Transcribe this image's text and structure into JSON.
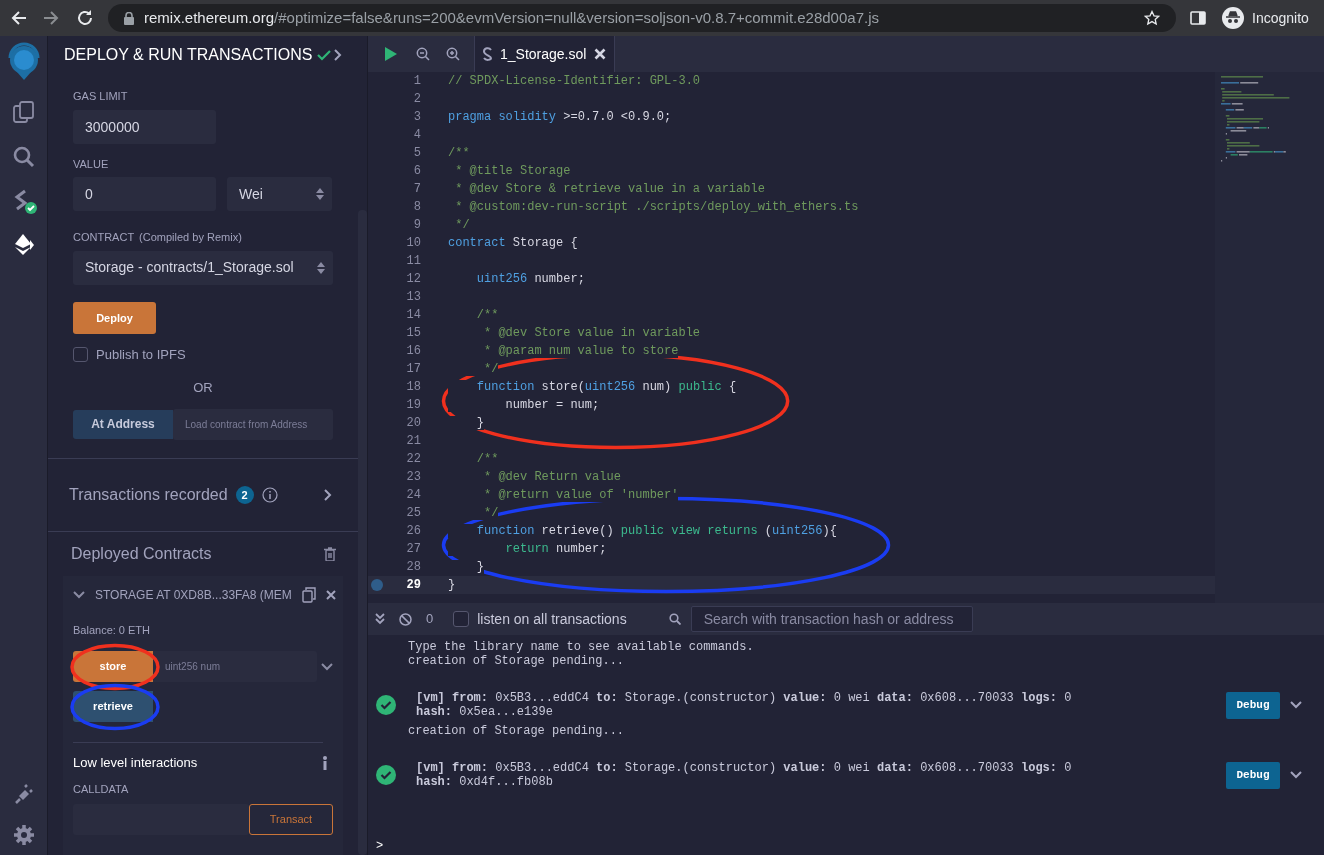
{
  "browser": {
    "url_host": "remix.ethereum.org",
    "url_path": "/#optimize=false&runs=200&evmVersion=null&version=soljson-v0.8.7+commit.e28d00a7.js",
    "profile": "Incognito"
  },
  "icon_rail": {
    "top": [
      {
        "kind": "files",
        "selected": false,
        "verified": false
      },
      {
        "kind": "search",
        "selected": false,
        "verified": false
      },
      {
        "kind": "compiler",
        "selected": false,
        "verified": true
      },
      {
        "kind": "deploy",
        "selected": true,
        "verified": false
      }
    ],
    "bottom": [
      {
        "kind": "plugins"
      },
      {
        "kind": "settings"
      }
    ]
  },
  "panel": {
    "title": "DEPLOY & RUN TRANSACTIONS",
    "verified": true,
    "gas_limit": {
      "label": "GAS LIMIT",
      "value": "3000000"
    },
    "value": {
      "label": "VALUE",
      "value": "0",
      "unit": "Wei"
    },
    "contract": {
      "label": "CONTRACT",
      "note": "(Compiled by Remix)",
      "value": "Storage - contracts/1_Storage.sol"
    },
    "deploy_button": "Deploy",
    "publish": {
      "label": "Publish to IPFS",
      "checked": false
    },
    "or_label": "OR",
    "at_address": {
      "button": "At Address",
      "placeholder": "Load contract from Address"
    },
    "transactions_recorded": {
      "label": "Transactions recorded",
      "count": "2"
    },
    "deployed": {
      "title": "Deployed Contracts",
      "instances": [
        {
          "title": "STORAGE AT 0XD8B...33FA8 (MEM",
          "expanded": true,
          "balance": "Balance: 0 ETH",
          "functions": [
            {
              "label": "store",
              "kind": "transact",
              "placeholder": "uint256 num",
              "color": "#f0301e"
            },
            {
              "label": "retrieve",
              "kind": "call",
              "color": "#1a3cf2"
            }
          ],
          "low_level": {
            "title": "Low level interactions",
            "calldata_label": "CALLDATA",
            "button": "Transact"
          }
        }
      ]
    }
  },
  "editor": {
    "tabs": [
      {
        "label": "1_Storage.sol",
        "selected": true
      }
    ],
    "lines": [
      {
        "number": "1",
        "current": false,
        "tokens": [
          {
            "kind": "comment",
            "text": "// SPDX-License-Identifier: GPL-3.0"
          }
        ]
      },
      {
        "number": "2",
        "current": false
      },
      {
        "number": "3",
        "current": false,
        "tokens": [
          {
            "kind": "keyword",
            "text": "pragma solidity"
          },
          {
            "kind": "plain",
            "text": " >=0.7.0 <0.9.0;"
          }
        ]
      },
      {
        "number": "4",
        "current": false
      },
      {
        "number": "5",
        "current": false,
        "tokens": [
          {
            "kind": "comment",
            "text": "/**"
          }
        ]
      },
      {
        "number": "6",
        "current": false,
        "tokens": [
          {
            "kind": "comment",
            "text": " * @title Storage"
          }
        ]
      },
      {
        "number": "7",
        "current": false,
        "tokens": [
          {
            "kind": "comment",
            "text": " * @dev Store & retrieve value in a variable"
          }
        ]
      },
      {
        "number": "8",
        "current": false,
        "tokens": [
          {
            "kind": "comment",
            "text": " * @custom:dev-run-script ./scripts/deploy_with_ethers.ts"
          }
        ]
      },
      {
        "number": "9",
        "current": false,
        "tokens": [
          {
            "kind": "comment",
            "text": " */"
          }
        ]
      },
      {
        "number": "10",
        "current": false,
        "tokens": [
          {
            "kind": "keyword",
            "text": "contract"
          },
          {
            "kind": "plain",
            "text": " Storage {"
          }
        ]
      },
      {
        "number": "11",
        "current": false
      },
      {
        "number": "12",
        "current": false,
        "tokens": [
          {
            "kind": "keyword",
            "text": "    uint256"
          },
          {
            "kind": "plain",
            "text": " number;"
          }
        ]
      },
      {
        "number": "13",
        "current": false
      },
      {
        "number": "14",
        "current": false,
        "tokens": [
          {
            "kind": "comment",
            "text": "    /**"
          }
        ]
      },
      {
        "number": "15",
        "current": false,
        "tokens": [
          {
            "kind": "comment",
            "text": "     * @dev Store value in variable"
          }
        ]
      },
      {
        "number": "16",
        "current": false,
        "tokens": [
          {
            "kind": "comment",
            "text": "     * @param num value to store"
          }
        ]
      },
      {
        "number": "17",
        "current": false,
        "tokens": [
          {
            "kind": "comment",
            "text": "     */"
          }
        ]
      },
      {
        "number": "18",
        "current": false,
        "color": "#f0301e",
        "tokens": [
          {
            "kind": "keyword",
            "text": "    function"
          },
          {
            "kind": "plain",
            "text": " store("
          },
          {
            "kind": "keyword",
            "text": "uint256"
          },
          {
            "kind": "plain",
            "text": " num) "
          },
          {
            "kind": "modifier",
            "text": "public"
          },
          {
            "kind": "plain",
            "text": " {"
          }
        ]
      },
      {
        "number": "19",
        "current": false,
        "color": "#f0301e",
        "tokens": [
          {
            "kind": "plain",
            "text": "        number = num;"
          }
        ]
      },
      {
        "number": "20",
        "current": false,
        "color": "#f0301e",
        "tokens": [
          {
            "kind": "plain",
            "text": "    }"
          }
        ]
      },
      {
        "number": "21",
        "current": false
      },
      {
        "number": "22",
        "current": false,
        "tokens": [
          {
            "kind": "comment",
            "text": "    /**"
          }
        ]
      },
      {
        "number": "23",
        "current": false,
        "tokens": [
          {
            "kind": "comment",
            "text": "     * @dev Return value"
          }
        ]
      },
      {
        "number": "24",
        "current": false,
        "tokens": [
          {
            "kind": "comment",
            "text": "     * @return value of 'number'"
          }
        ]
      },
      {
        "number": "25",
        "current": false,
        "tokens": [
          {
            "kind": "comment",
            "text": "     */"
          }
        ]
      },
      {
        "number": "26",
        "current": false,
        "color": "#1a3cf2",
        "tokens": [
          {
            "kind": "keyword",
            "text": "    function"
          },
          {
            "kind": "plain",
            "text": " retrieve() "
          },
          {
            "kind": "modifier",
            "text": "public view returns"
          },
          {
            "kind": "plain",
            "text": " ("
          },
          {
            "kind": "keyword",
            "text": "uint256"
          },
          {
            "kind": "plain",
            "text": "){"
          }
        ]
      },
      {
        "number": "27",
        "current": false,
        "color": "#1a3cf2",
        "tokens": [
          {
            "kind": "modifier",
            "text": "        return"
          },
          {
            "kind": "plain",
            "text": " number;"
          }
        ]
      },
      {
        "number": "28",
        "current": false,
        "color": "#1a3cf2",
        "tokens": [
          {
            "kind": "plain",
            "text": "    }"
          }
        ]
      },
      {
        "number": "29",
        "current": true,
        "tokens": [
          {
            "kind": "plain",
            "text": "}"
          }
        ]
      }
    ]
  },
  "terminal": {
    "pending_count": "0",
    "listen": {
      "label": "listen on all transactions",
      "checked": false
    },
    "search": {
      "placeholder": "Search with transaction hash or address"
    },
    "log": [
      {
        "kind": "text",
        "text": "Type the library name to see available commands."
      },
      {
        "kind": "text",
        "text": "creation of Storage pending..."
      },
      {
        "kind": "tx",
        "succeeded": true,
        "summary": "**[vm]**  **from:** 0x5B3...eddC4 **to:** Storage.(constructor) **value:** 0 wei **data:** 0x608...70033 **logs:** 0",
        "hash": "**hash:** 0x5ea...e139e",
        "button": "Debug"
      },
      {
        "kind": "text",
        "text": "creation of Storage pending..."
      },
      {
        "kind": "tx",
        "succeeded": true,
        "summary": "**[vm]**  **from:** 0x5B3...eddC4 **to:** Storage.(constructor) **value:** 0 wei **data:** 0x608...70033 **logs:** 0",
        "hash": "**hash:** 0xd4f...fb08b",
        "button": "Debug"
      }
    ],
    "prompt": ">"
  }
}
